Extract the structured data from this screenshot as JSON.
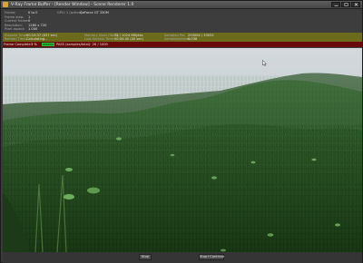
{
  "window": {
    "title": "V-Ray Frame Buffer - [Render Window] - Scene Renderer 1.0"
  },
  "info_left": [
    {
      "label": "Frame:",
      "value": "0 to 0"
    },
    {
      "label": "Frame step:",
      "value": "1"
    },
    {
      "label": "Current frame:",
      "value": "0"
    },
    {
      "label": "Resolution:",
      "value": "1280 x 720"
    },
    {
      "label": "Pixel aspect:",
      "value": "1.000"
    }
  ],
  "info_gpu": {
    "label": "GPU: 1 (active)",
    "value": "GeForce GT 330M"
  },
  "yellow_left": [
    {
      "label": "Elapsed Time:",
      "value": "00:10:37 (637 sec)"
    },
    {
      "label": "Remain Time:",
      "value": "Calculating..."
    }
  ],
  "yellow_mid": [
    {
      "label": "Memory Used (Total):",
      "value": "72 / 1024 MBytes"
    },
    {
      "label": "Last Section Time:",
      "value": "00:00:40 (40 sec)"
    }
  ],
  "yellow_right": [
    {
      "label": "Sampled Pix:",
      "value": "250004 / 33052"
    },
    {
      "label": "Samples/pix/sec:",
      "value": "0.036"
    }
  ],
  "status": {
    "label": "Frame Complete",
    "percent": "3 %",
    "mode": "RENDER",
    "text": "PASS (samples/total): 26 / 1000"
  },
  "buttons": {
    "stop": "Stop",
    "stop_continue": "Stop+Continue"
  }
}
